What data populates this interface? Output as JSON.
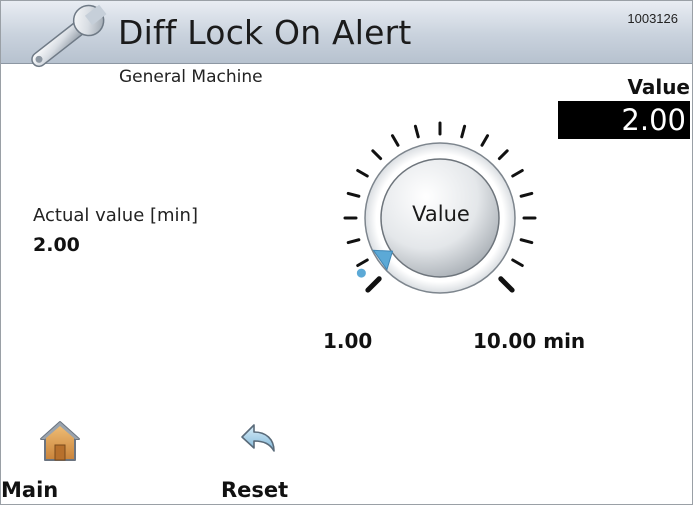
{
  "header": {
    "title": "Diff Lock On Alert",
    "code": "1003126",
    "icon": "wrench-icon"
  },
  "subtitle": "General Machine",
  "value_panel": {
    "label": "Value",
    "current": "2.00"
  },
  "actual": {
    "label": "Actual value [min]",
    "value": "2.00"
  },
  "dial": {
    "knob_label": "Value",
    "min_label": "1.00",
    "max_label": "10.00 min",
    "min": 1.0,
    "max": 10.0,
    "value": 2.0,
    "pointer_color": "#5ca9d6"
  },
  "nav": {
    "main": {
      "label": "Main",
      "icon": "home-icon"
    },
    "reset": {
      "label": "Reset",
      "icon": "undo-arrow-icon"
    }
  },
  "colors": {
    "header_gradient_top": "#e9edf3",
    "header_gradient_bottom": "#b7c2cf",
    "value_box_bg": "#000000",
    "value_box_fg": "#ffffff"
  }
}
